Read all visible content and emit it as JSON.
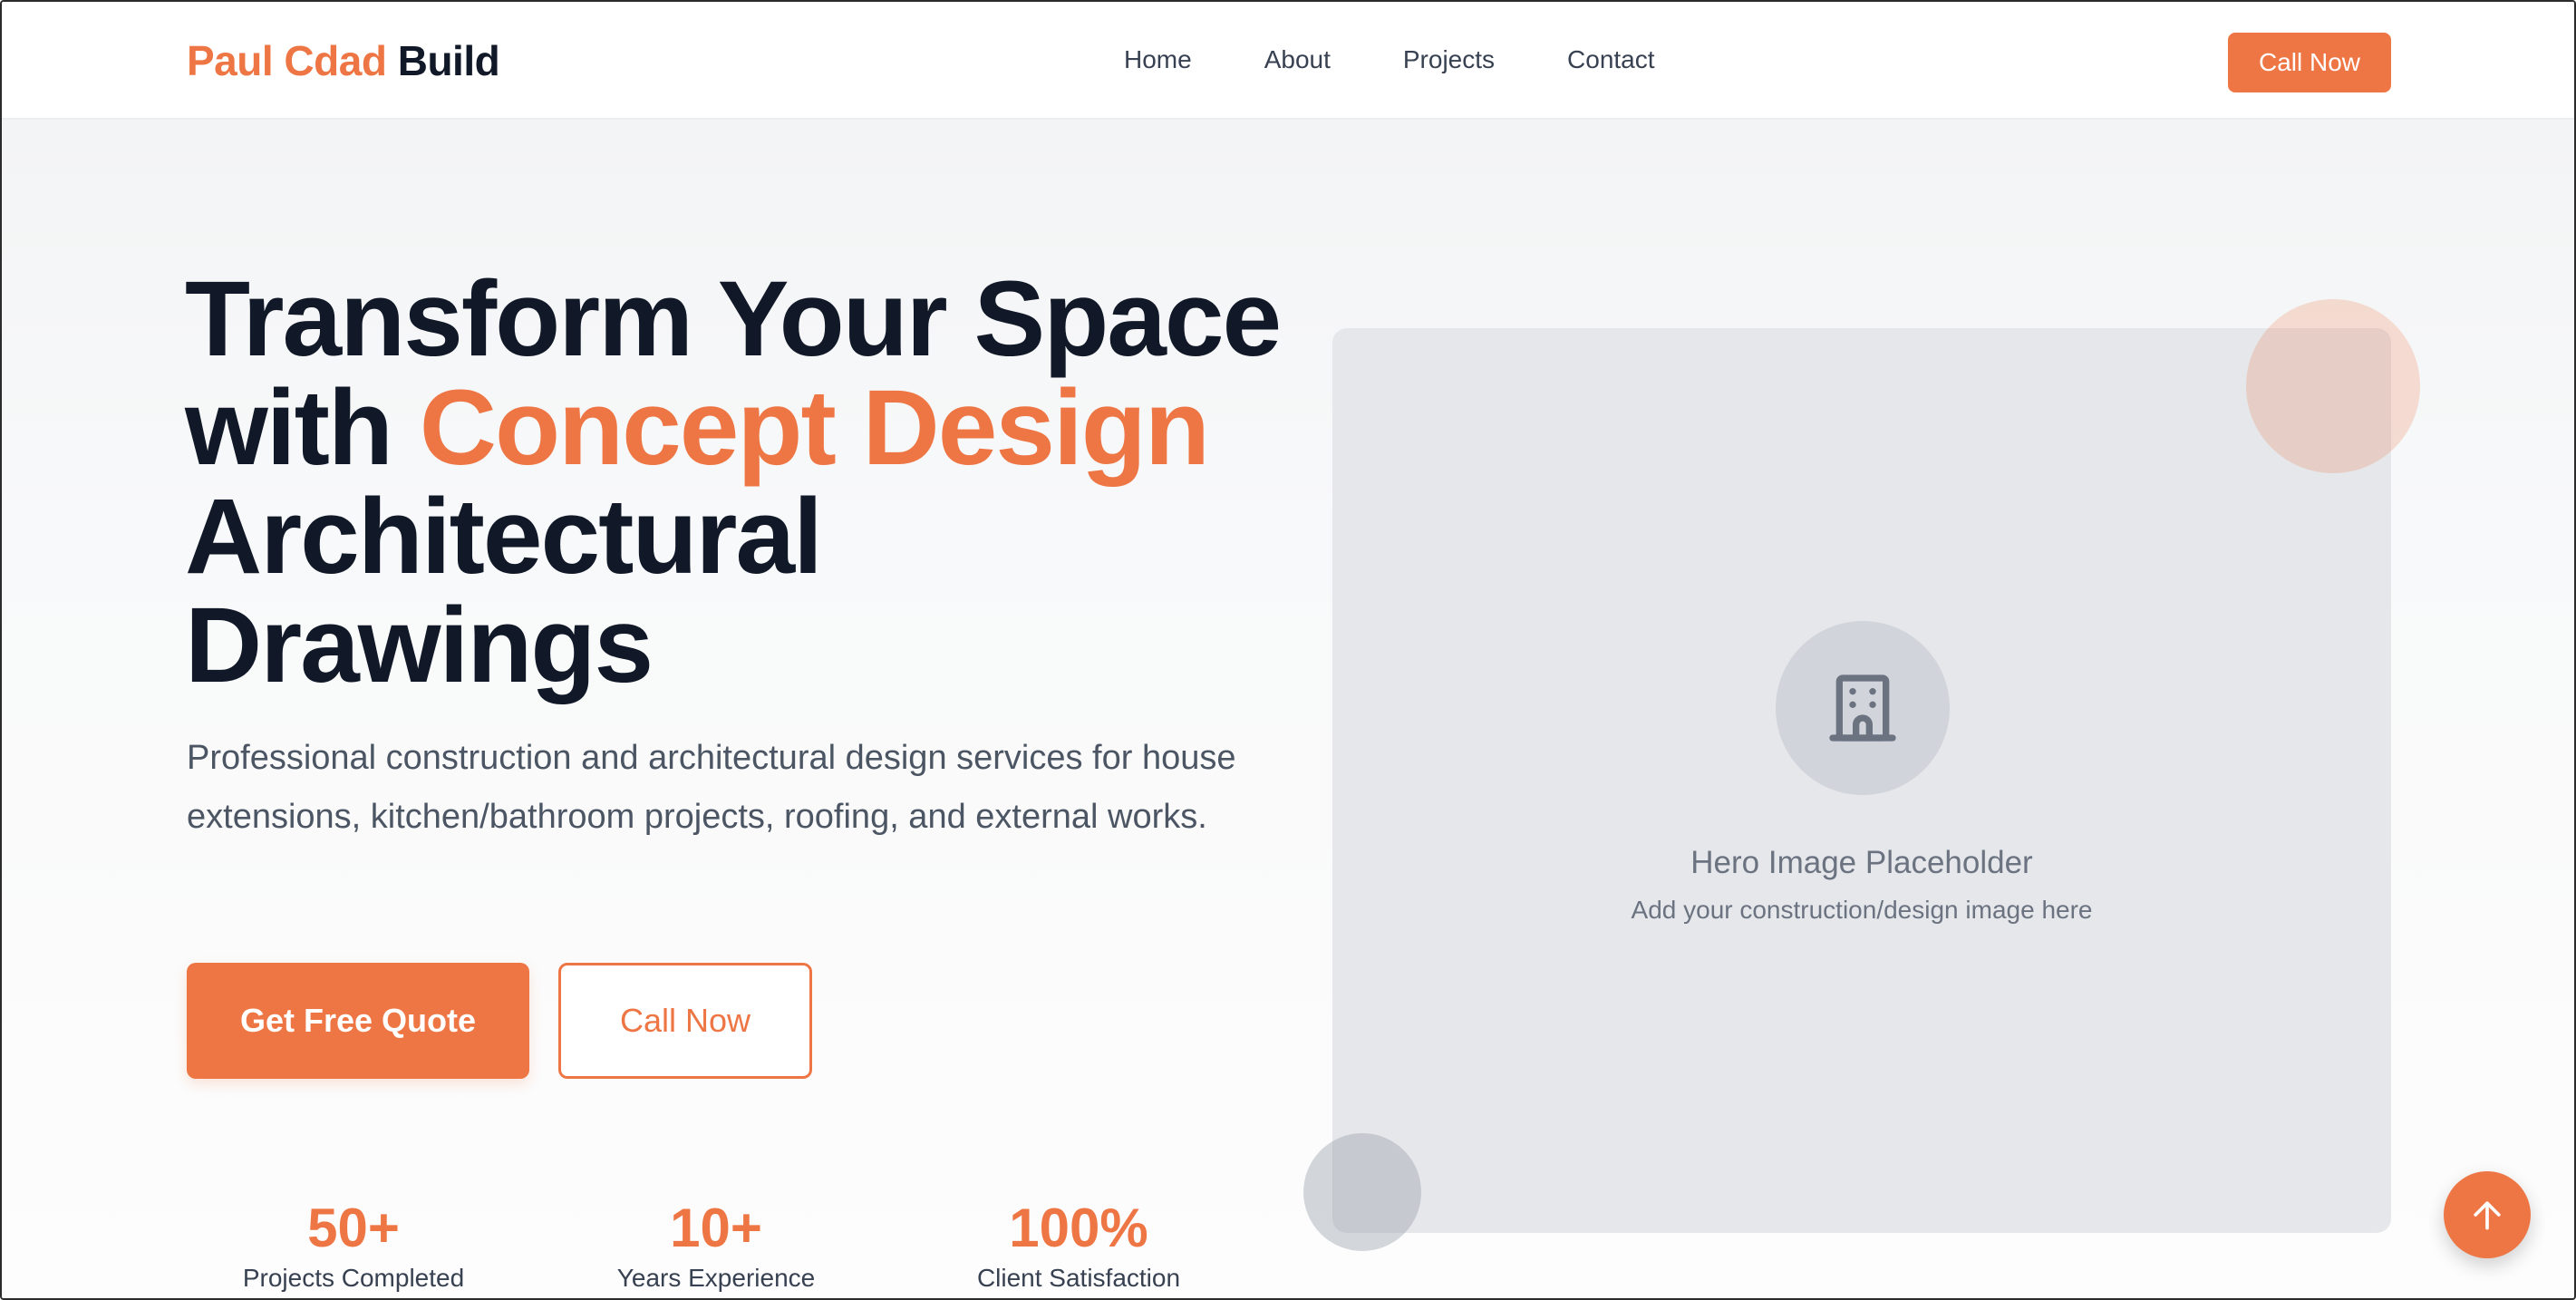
{
  "brand": {
    "name_accent": "Paul Cdad",
    "name_rest": "Build",
    "accent_color": "#ee7644",
    "dark_color": "#111827"
  },
  "nav": {
    "links": [
      "Home",
      "About",
      "Projects",
      "Contact"
    ],
    "cta_label": "Call Now"
  },
  "hero": {
    "title_part1": "Transform Your Space with ",
    "title_accent": "Concept Design",
    "title_part2": " Architectural Drawings",
    "description": "Professional construction and architectural design services for house extensions, kitchen/bathroom projects, roofing, and external works.",
    "primary_cta": "Get Free Quote",
    "secondary_cta": "Call Now",
    "image": {
      "icon": "building-icon",
      "title": "Hero Image Placeholder",
      "subtitle": "Add your construction/design image here"
    }
  },
  "stats": [
    {
      "value": "50+",
      "label": "Projects Completed"
    },
    {
      "value": "10+",
      "label": "Years Experience"
    },
    {
      "value": "100%",
      "label": "Client Satisfaction"
    }
  ],
  "scroll_top": {
    "icon": "arrow-up-icon"
  }
}
